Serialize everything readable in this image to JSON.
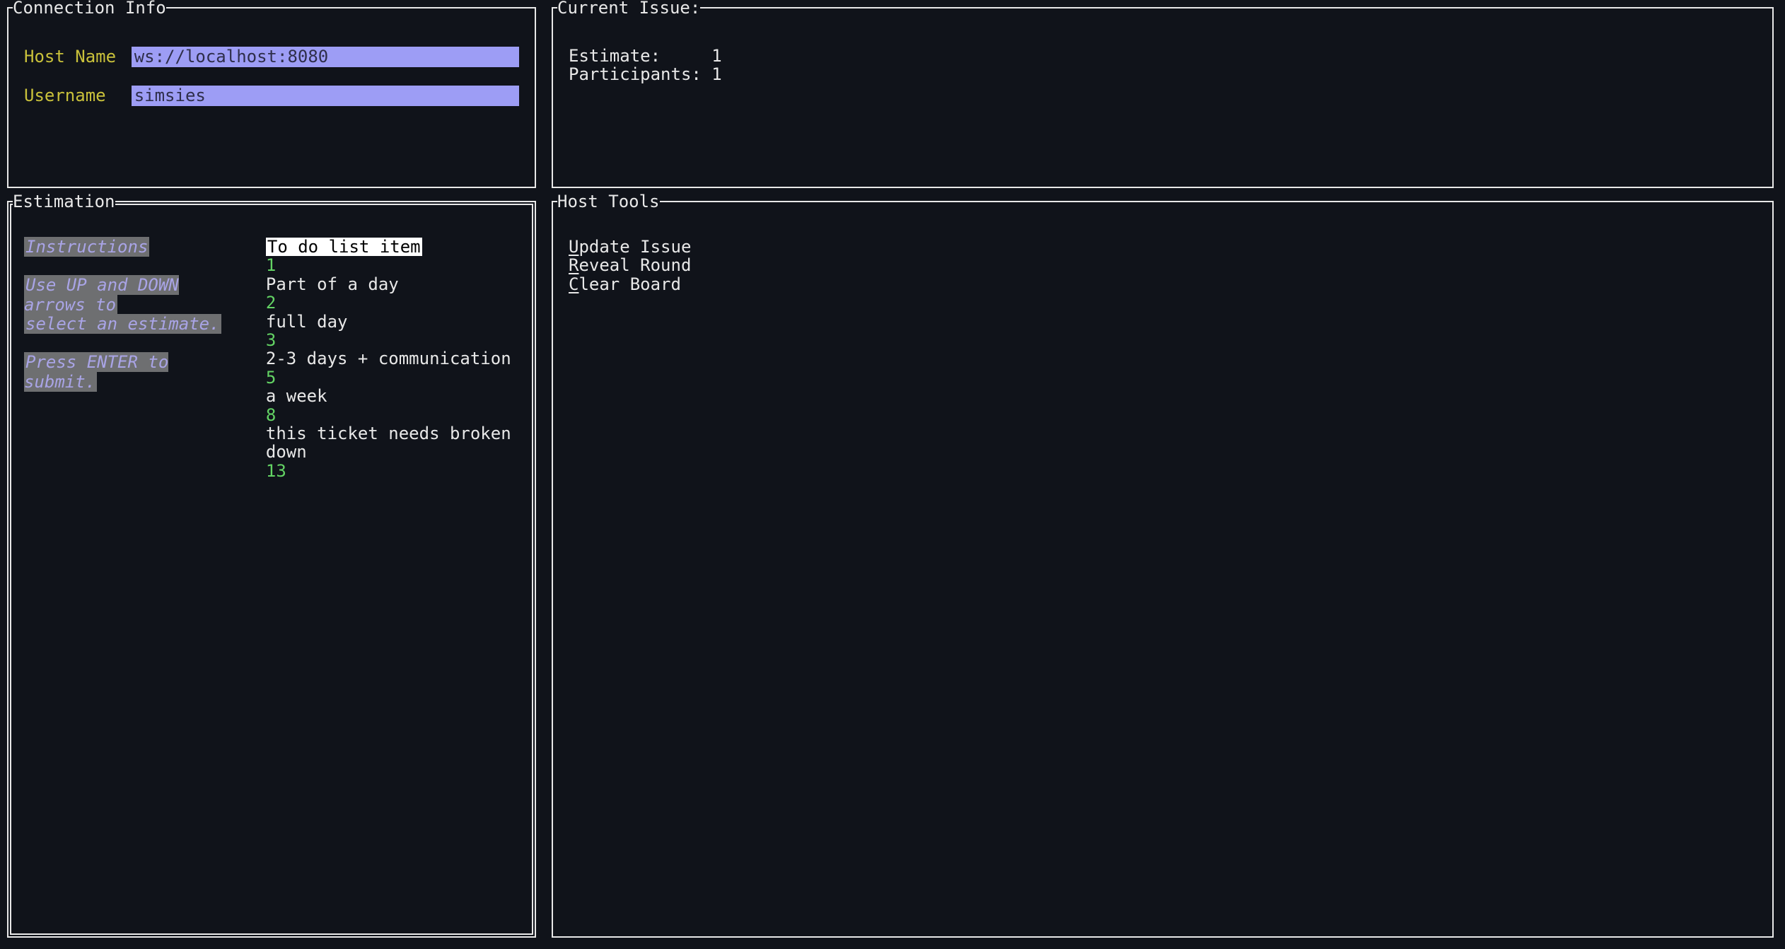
{
  "panels": {
    "connection": {
      "title": "Connection Info",
      "host_label": "Host Name",
      "host_value": "ws://localhost:8080",
      "user_label": "Username",
      "user_value": "simsies"
    },
    "current_issue": {
      "title": "Current Issue:",
      "estimate_label": "Estimate:",
      "estimate_value": "1",
      "participants_label": "Participants:",
      "participants_value": "1"
    },
    "estimation": {
      "title": "Estimation",
      "instructions": {
        "heading": "Instructions",
        "line1a": "Use UP and DOWN arrows to",
        "line1b": "select an estimate.",
        "line2": "Press ENTER to submit."
      },
      "selected_index": 0,
      "options": [
        {
          "label": "To do list item",
          "value": "1"
        },
        {
          "label": "Part of a day",
          "value": "2"
        },
        {
          "label": "full day",
          "value": "3"
        },
        {
          "label": "2-3 days + communication",
          "value": "5"
        },
        {
          "label": "a week",
          "value": "8"
        },
        {
          "label": "this ticket needs broken down",
          "value": "13"
        }
      ]
    },
    "host_tools": {
      "title": "Host Tools",
      "items": [
        {
          "key": "U",
          "text": "pdate Issue"
        },
        {
          "key": "R",
          "text": "eveal Round"
        },
        {
          "key": "C",
          "text": "lear Board"
        }
      ]
    }
  },
  "colors": {
    "background": "#10131a",
    "foreground": "#e8e8e8",
    "label": "#c9c13b",
    "input_bg": "#9d9df5",
    "option_num": "#63d364"
  }
}
